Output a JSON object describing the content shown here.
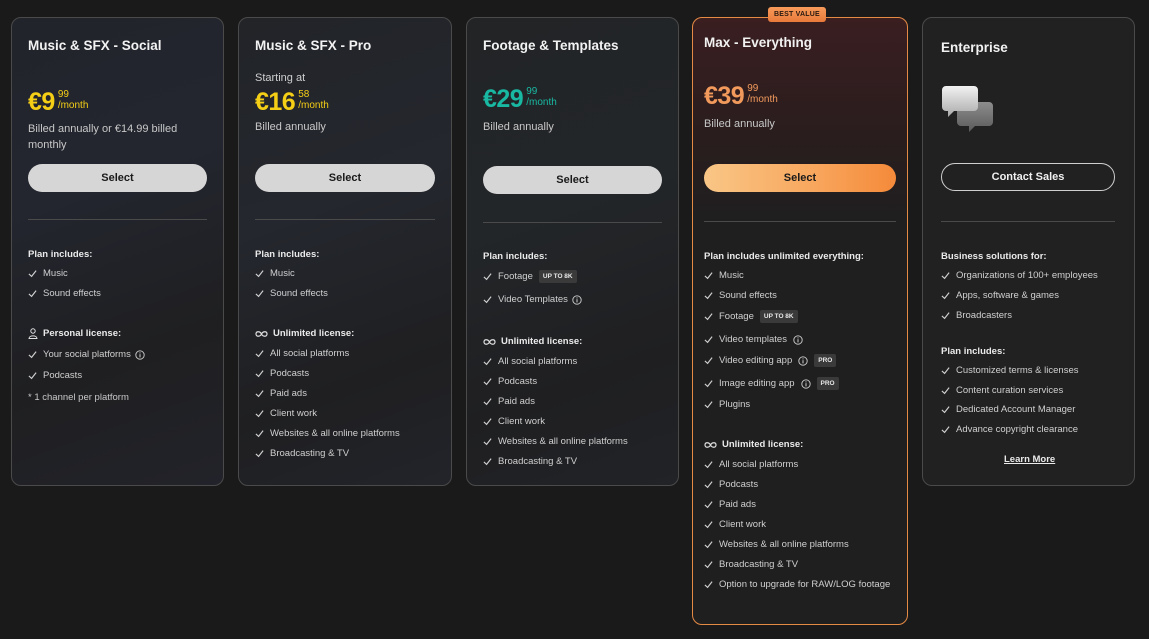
{
  "plans": {
    "social": {
      "title": "Music & SFX - Social",
      "currency_amount": "€9",
      "cents": "99",
      "per": "/month",
      "billed_line1": "Billed annually or €14.99 billed",
      "billed_line2": "monthly",
      "button": "Select",
      "includes_heading": "Plan includes:",
      "includes": [
        "Music",
        "Sound effects"
      ],
      "license_heading": "Personal license:",
      "license_items": [
        "Your social platforms",
        "Podcasts"
      ],
      "note": "* 1 channel per platform"
    },
    "pro": {
      "title": "Music & SFX - Pro",
      "starting": "Starting at",
      "currency_amount": "€16",
      "cents": "58",
      "per": "/month",
      "billed": "Billed annually",
      "button": "Select",
      "includes_heading": "Plan includes:",
      "includes": [
        "Music",
        "Sound effects"
      ],
      "license_heading": "Unlimited license:",
      "license_items": [
        "All social platforms",
        "Podcasts",
        "Paid ads",
        "Client work",
        "Websites & all online platforms",
        "Broadcasting & TV"
      ]
    },
    "footage": {
      "title": "Footage & Templates",
      "currency_amount": "€29",
      "cents": "99",
      "per": "/month",
      "billed": "Billed annually",
      "button": "Select",
      "includes_heading": "Plan includes:",
      "includes": [
        "Footage",
        "Video Templates"
      ],
      "footage_tag": "UP TO 8K",
      "license_heading": "Unlimited license:",
      "license_items": [
        "All social platforms",
        "Podcasts",
        "Paid ads",
        "Client work",
        "Websites & all online platforms",
        "Broadcasting & TV"
      ]
    },
    "max": {
      "badge": "BEST VALUE",
      "title": "Max - Everything",
      "currency_amount": "€39",
      "cents": "99",
      "per": "/month",
      "billed": "Billed annually",
      "button": "Select",
      "includes_heading": "Plan includes unlimited everything:",
      "includes": [
        "Music",
        "Sound effects",
        "Footage",
        "Video templates",
        "Video editing app",
        "Image editing app",
        "Plugins"
      ],
      "footage_tag": "UP TO 8K",
      "pro_tag": "PRO",
      "license_heading": "Unlimited license:",
      "license_items": [
        "All social platforms",
        "Podcasts",
        "Paid ads",
        "Client work",
        "Websites & all online platforms",
        "Broadcasting & TV",
        "Option to upgrade for RAW/LOG footage"
      ]
    },
    "enterprise": {
      "title": "Enterprise",
      "button": "Contact Sales",
      "business_heading": "Business solutions for:",
      "business_items": [
        "Organizations of 100+ employees",
        "Apps, software & games",
        "Broadcasters"
      ],
      "includes_heading": "Plan includes:",
      "includes": [
        "Customized terms & licenses",
        "Content curation services",
        "Dedicated Account Manager",
        "Advance copyright clearance"
      ],
      "learn_more": "Learn More"
    }
  },
  "colors": {
    "yellow": "#f5cf16",
    "teal": "#18b8a2",
    "orange": "#f29a5c",
    "max_border": "#e58a44"
  }
}
